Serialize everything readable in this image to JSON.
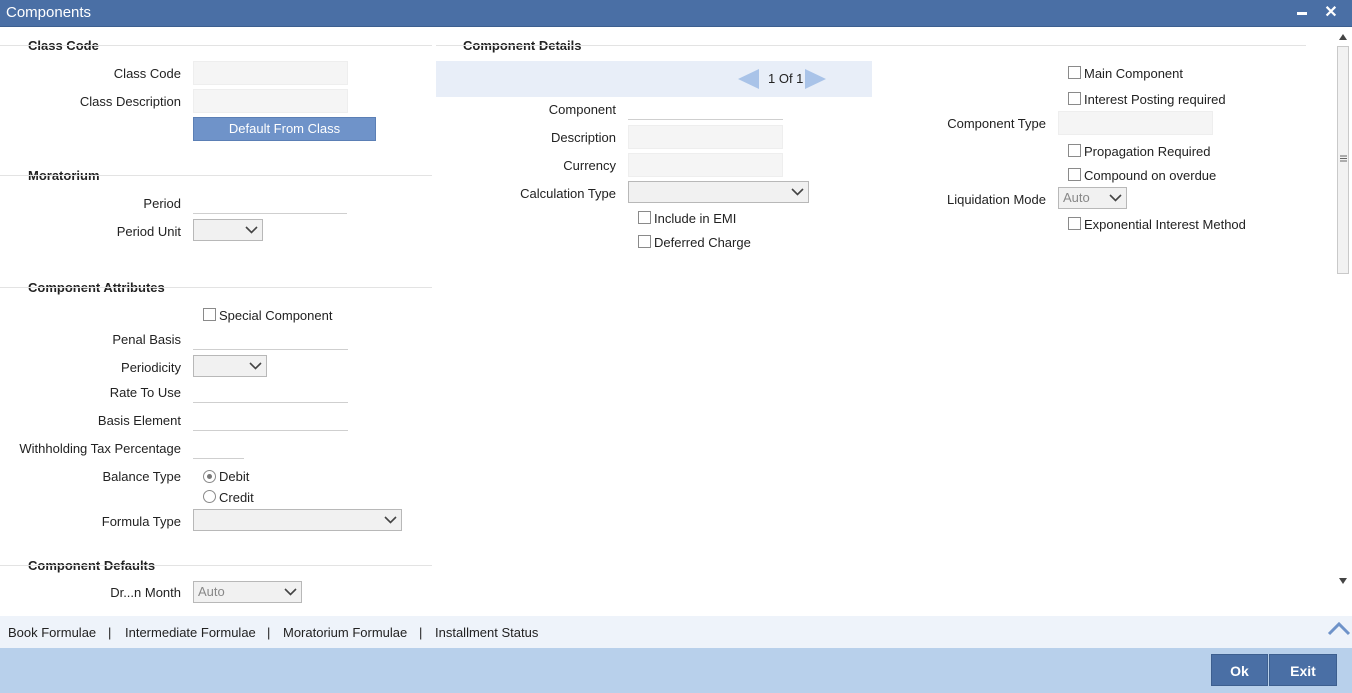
{
  "window": {
    "title": "Components",
    "minimize": "▬",
    "close": "✕"
  },
  "class_code": {
    "heading": "Class Code",
    "class_code_label": "Class Code",
    "class_desc_label": "Class Description",
    "default_button": "Default From Class"
  },
  "moratorium": {
    "heading": "Moratorium",
    "period_label": "Period",
    "period_unit_label": "Period Unit"
  },
  "attributes": {
    "heading": "Component Attributes",
    "special_component": "Special Component",
    "penal_basis": "Penal Basis",
    "periodicity": "Periodicity",
    "rate_to_use": "Rate To Use",
    "basis_element": "Basis Element",
    "withholding_tax": "Withholding Tax Percentage",
    "balance_type": "Balance Type",
    "debit": "Debit",
    "credit": "Credit",
    "balance_type_selected": "Debit",
    "formula_type": "Formula Type"
  },
  "defaults": {
    "heading": "Component Defaults",
    "partial_label": "Dr...n Month",
    "partial_value": "Auto"
  },
  "details": {
    "heading": "Component Details",
    "pager_text": "1 Of 1",
    "component": "Component",
    "description": "Description",
    "currency": "Currency",
    "calculation_type": "Calculation Type",
    "include_emi": "Include in EMI",
    "deferred_charge": "Deferred Charge"
  },
  "right": {
    "main_component": "Main Component",
    "interest_posting": "Interest Posting required",
    "component_type": "Component Type",
    "propagation": "Propagation Required",
    "compound_overdue": "Compound on overdue",
    "liquidation_mode": "Liquidation Mode",
    "liquidation_value": "Auto",
    "exponential": "Exponential Interest Method"
  },
  "links": {
    "book": "Book Formulae",
    "intermediate": "Intermediate Formulae",
    "moratorium": "Moratorium Formulae",
    "installment": "Installment Status",
    "separator": "|"
  },
  "footer": {
    "ok": "Ok",
    "exit": "Exit"
  }
}
